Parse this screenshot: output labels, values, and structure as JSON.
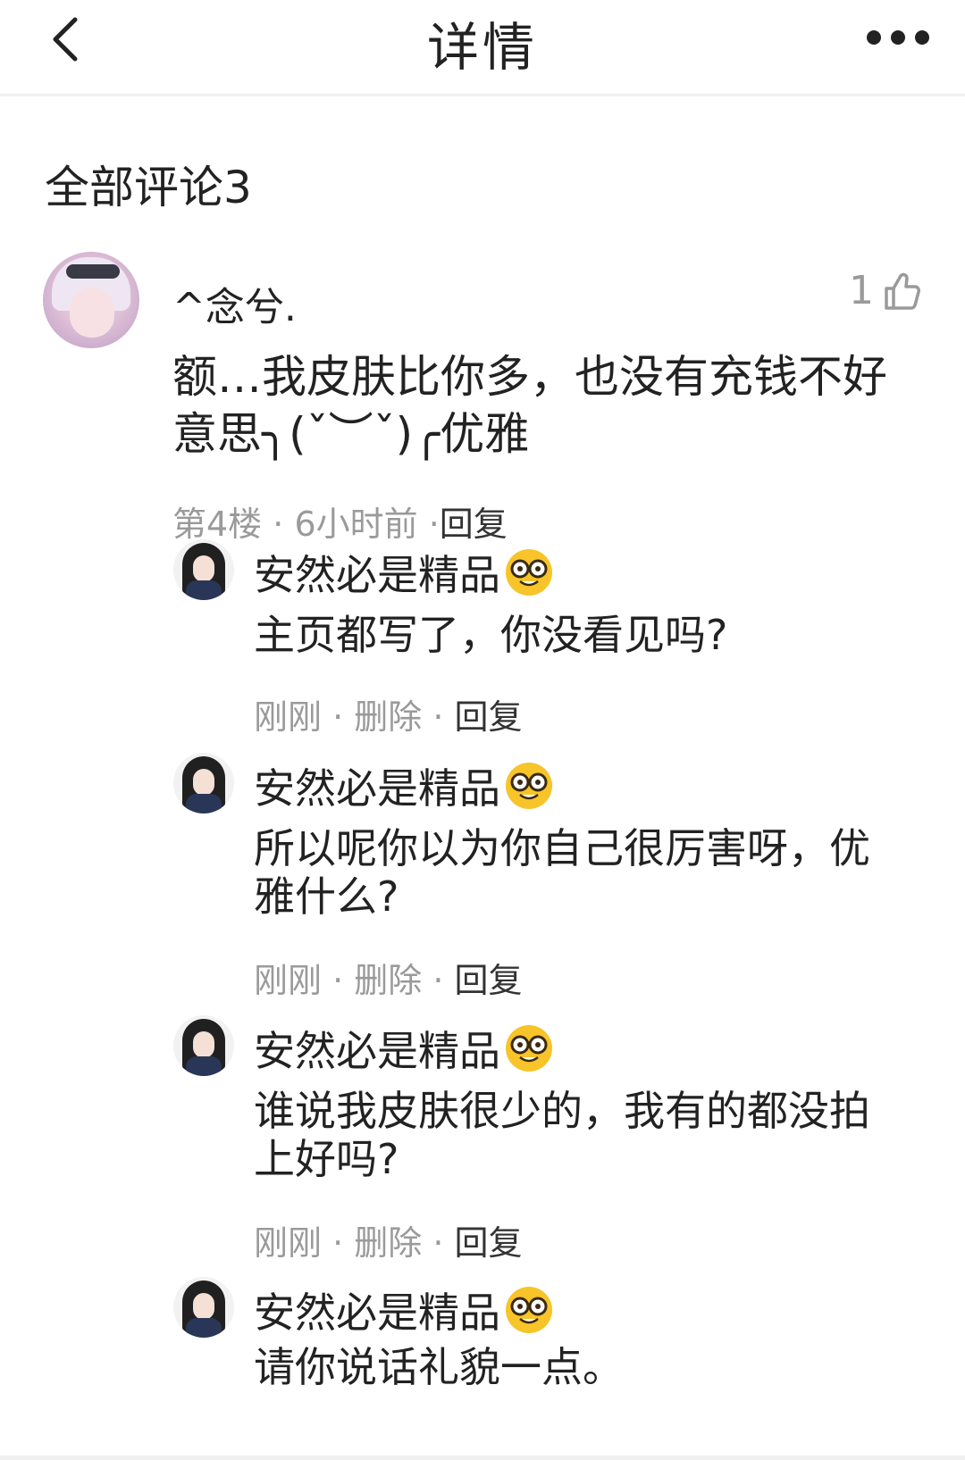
{
  "header": {
    "title": "详情"
  },
  "section": {
    "title": "全部评论3"
  },
  "main_comment": {
    "username": "^念兮.",
    "like_count": "1",
    "text": "额…我皮肤比你多，也没有充钱不好意思╮(ˇ︶ˇ)╭优雅",
    "floor": "第4楼",
    "sep1": " · ",
    "time": "6小时前",
    "sep2": " ·",
    "reply": "回复"
  },
  "replies": [
    {
      "name": "安然必是精品",
      "text": "主页都写了，你没看见吗?",
      "time": "刚刚",
      "sep1": " · ",
      "delete": "删除",
      "sep2": " · ",
      "reply": "回复"
    },
    {
      "name": "安然必是精品",
      "text": "所以呢你以为你自己很厉害呀，优雅什么?",
      "time": "刚刚",
      "sep1": " · ",
      "delete": "删除",
      "sep2": " · ",
      "reply": "回复"
    },
    {
      "name": "安然必是精品",
      "text": "谁说我皮肤很少的，我有的都没拍上好吗?",
      "time": "刚刚",
      "sep1": " · ",
      "delete": "删除",
      "sep2": " · ",
      "reply": "回复"
    },
    {
      "name": "安然必是精品",
      "text": "请你说话礼貌一点。"
    }
  ],
  "icons": {
    "back": "chevron-left-icon",
    "more": "more-dots-icon",
    "like": "thumbs-up-icon",
    "emoji": "nerd-face-emoji"
  }
}
